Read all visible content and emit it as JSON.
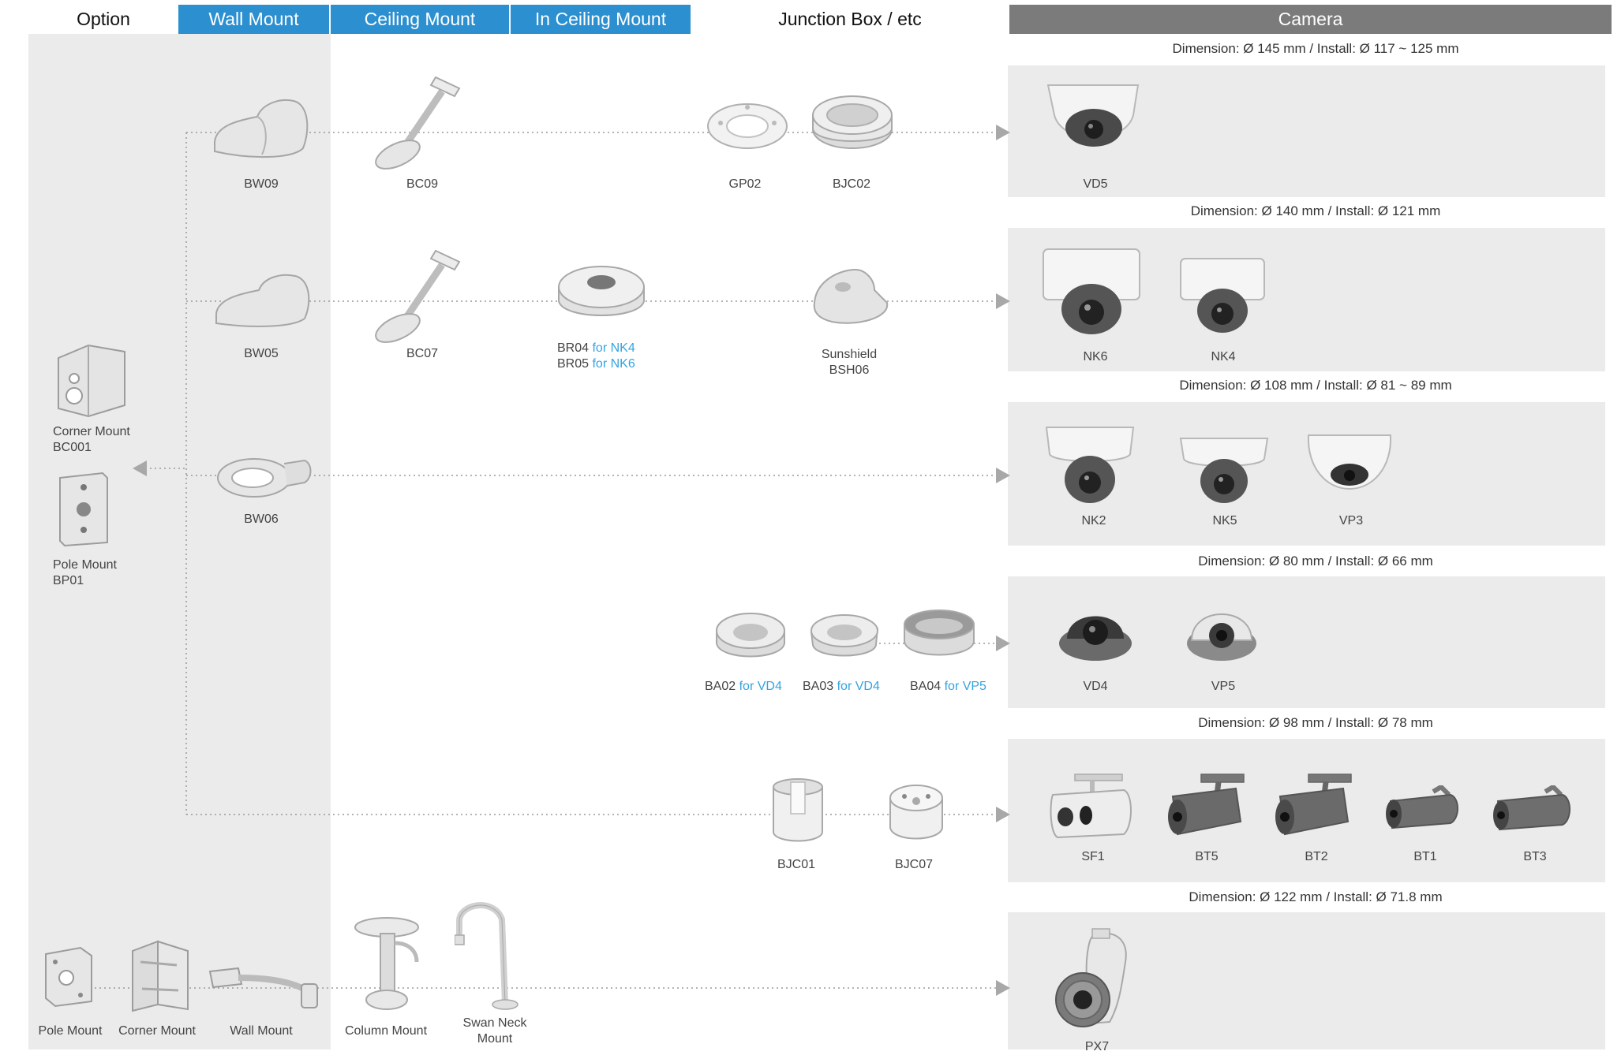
{
  "header": {
    "option": "Option",
    "wall_mount": "Wall Mount",
    "ceiling_mount": "Ceiling Mount",
    "in_ceiling_mount": "In Ceiling Mount",
    "junction_box": "Junction Box / etc",
    "camera": "Camera"
  },
  "colors": {
    "header_blue": "#2b8fd0",
    "header_gray": "#7b7b7b",
    "panel": "#ebebeb",
    "accent_for": "#35a3df"
  },
  "options": {
    "corner_mount": {
      "line1": "Corner Mount",
      "line2": "BC001"
    },
    "pole_mount": {
      "line1": "Pole Mount",
      "line2": "BP01"
    }
  },
  "rows": [
    {
      "dimension": "Dimension: Ø 145 mm / Install: Ø 117 ~ 125 mm",
      "wall": "BW09",
      "ceiling": "BC09",
      "junction": [
        "GP02",
        "BJC02"
      ],
      "cameras": [
        "VD5"
      ]
    },
    {
      "dimension": "Dimension: Ø 140 mm / Install: Ø 121 mm",
      "wall": "BW05",
      "ceiling": "BC07",
      "in_ceiling": [
        {
          "code": "BR04",
          "for": "for NK4"
        },
        {
          "code": "BR05",
          "for": "for NK6"
        }
      ],
      "junction_lines": [
        "Sunshield",
        "BSH06"
      ],
      "cameras": [
        "NK6",
        "NK4"
      ]
    },
    {
      "dimension": "Dimension: Ø 108 mm / Install: Ø 81 ~ 89 mm",
      "wall": "BW06",
      "cameras": [
        "NK2",
        "NK5",
        "VP3"
      ]
    },
    {
      "dimension": "Dimension: Ø 80 mm / Install: Ø 66 mm",
      "junction_for": [
        {
          "code": "BA02",
          "for": "for VD4"
        },
        {
          "code": "BA03",
          "for": "for VD4"
        },
        {
          "code": "BA04",
          "for": "for VP5"
        }
      ],
      "cameras": [
        "VD4",
        "VP5"
      ]
    },
    {
      "dimension": "Dimension: Ø 98 mm / Install: Ø 78 mm",
      "junction": [
        "BJC01",
        "BJC07"
      ],
      "cameras": [
        "SF1",
        "BT5",
        "BT2",
        "BT1",
        "BT3"
      ]
    },
    {
      "dimension": "Dimension: Ø 122 mm / Install: Ø 71.8 mm",
      "mounts": [
        "Pole Mount",
        "Corner Mount",
        "Wall Mount",
        "Column Mount"
      ],
      "swan_neck": [
        "Swan Neck",
        "Mount"
      ],
      "cameras": [
        "PX7"
      ]
    }
  ]
}
